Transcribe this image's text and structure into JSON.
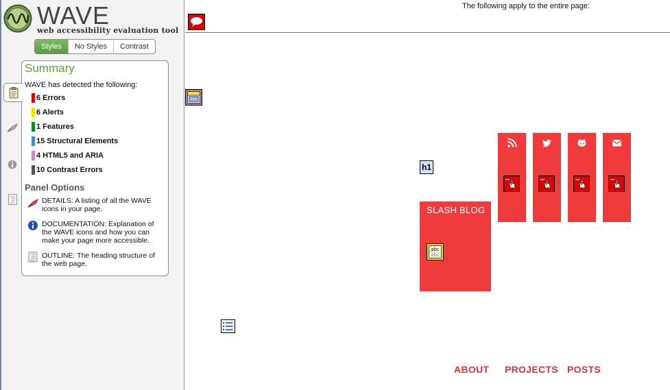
{
  "logo": {
    "title": "WAVE",
    "subtitle": "web accessibility evaluation tool"
  },
  "view_toggle": [
    "Styles",
    "No Styles",
    "Contrast"
  ],
  "sidebar_tabs": [
    "clipboard-icon",
    "flag-icon",
    "info-icon",
    "outline-icon"
  ],
  "summary": {
    "title": "Summary",
    "intro": "WAVE has detected the following:",
    "items": [
      {
        "label": "6 Errors",
        "color": "#e00000"
      },
      {
        "label": "6 Alerts",
        "color": "#f5e200"
      },
      {
        "label": "1 Features",
        "color": "#138a13"
      },
      {
        "label": "15 Structural Elements",
        "color": "#3d8fd6"
      },
      {
        "label": "4 HTML5 and ARIA",
        "color": "#c887c8"
      },
      {
        "label": "10 Contrast Errors",
        "color": "#555555"
      }
    ]
  },
  "panel_options": {
    "title": "Panel Options",
    "items": [
      {
        "icon": "flag-icon",
        "text": "DETAILS: A listing of all the WAVE icons in your page."
      },
      {
        "icon": "info-icon",
        "text": "DOCUMENTATION: Explanation of the WAVE icons and how you can make your page more accessible."
      },
      {
        "icon": "outline-icon",
        "text": "OUTLINE: The heading structure of the web page."
      }
    ]
  },
  "page": {
    "notice": "The following apply to the entire page:",
    "h1_label": "h1",
    "blog_title": "SLASH BLOG",
    "social_icons": [
      "rss-icon",
      "twitter-icon",
      "github-icon",
      "email-icon"
    ],
    "nav": [
      "ABOUT",
      "PROJECTS",
      "POSTS"
    ]
  },
  "colors": {
    "error_red": "#ef3b3b",
    "nav_red": "#e0322f",
    "summary_green": "#6a9a3a"
  }
}
